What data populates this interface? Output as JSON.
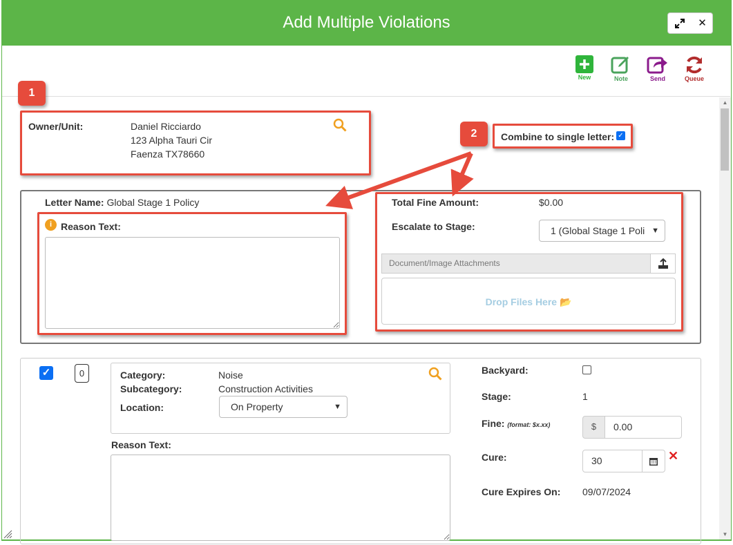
{
  "window": {
    "title": "Add Multiple Violations",
    "expand_icon": "expand-icon",
    "close_label": "✕"
  },
  "toolbar": {
    "items": [
      {
        "label": "New",
        "icon": "plus-icon",
        "color": "#2fb53b"
      },
      {
        "label": "Note",
        "icon": "edit-icon",
        "color": "#4aa35c"
      },
      {
        "label": "Send",
        "icon": "send-icon",
        "color": "#8b1b8c"
      },
      {
        "label": "Queue",
        "icon": "refresh-icon",
        "color": "#b22d2d"
      }
    ]
  },
  "annotations": {
    "badge1": "1",
    "badge2": "2",
    "accent": "#e64b3c"
  },
  "owner": {
    "label": "Owner/Unit:",
    "name": "Daniel Ricciardo",
    "address1": "123 Alpha Tauri Cir",
    "address2": "Faenza TX78660"
  },
  "combine": {
    "label": "Combine to single letter:",
    "checked": true
  },
  "letter": {
    "name_label": "Letter Name:",
    "name_value": "Global Stage 1 Policy",
    "reason_label": "Reason Text:",
    "reason_value": "",
    "total_fine_label": "Total Fine Amount:",
    "total_fine_value": "$0.00",
    "escalate_label": "Escalate to Stage:",
    "escalate_value": "1 (Global Stage 1 Poli",
    "attachments_label": "Document/Image Attachments",
    "drop_label": "Drop Files Here"
  },
  "violation": {
    "checked": true,
    "count": "0",
    "category_label": "Category:",
    "category_value": "Noise",
    "subcategory_label": "Subcategory:",
    "subcategory_value": "Construction Activities",
    "location_label": "Location:",
    "location_value": "On Property",
    "reason_label": "Reason Text:",
    "backyard_label": "Backyard:",
    "stage_label": "Stage:",
    "stage_value": "1",
    "fine_label": "Fine:",
    "fine_hint": "(format: $x.xx)",
    "fine_prefix": "$",
    "fine_value": "0.00",
    "cure_label": "Cure:",
    "cure_value": "30",
    "cure_expires_label": "Cure Expires On:",
    "cure_expires_value": "09/07/2024"
  }
}
